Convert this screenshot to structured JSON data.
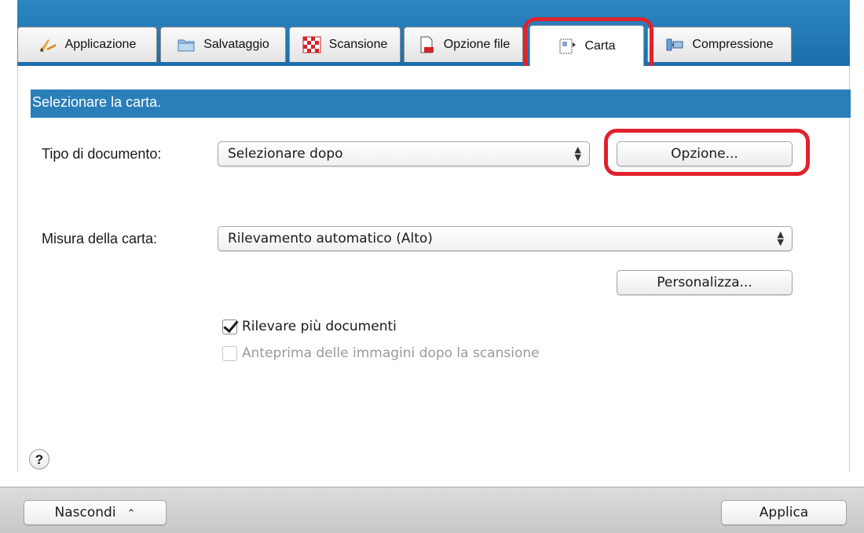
{
  "tabs": [
    {
      "label": "Applicazione",
      "icon": "pencil-icon"
    },
    {
      "label": "Salvataggio",
      "icon": "folder-icon"
    },
    {
      "label": "Scansione",
      "icon": "checker-icon"
    },
    {
      "label": "Opzione file",
      "icon": "file-icon"
    },
    {
      "label": "Carta",
      "icon": "paper-icon"
    },
    {
      "label": "Compressione",
      "icon": "compress-icon"
    }
  ],
  "section_title": "Selezionare la carta.",
  "document_type": {
    "label": "Tipo di documento:",
    "value": "Selezionare dopo",
    "option_button": "Opzione..."
  },
  "paper_size": {
    "label": "Misura della carta:",
    "value": "Rilevamento automatico (Alto)",
    "custom_button": "Personalizza..."
  },
  "checkboxes": {
    "multifeed": {
      "label": "Rilevare più documenti",
      "checked": true
    },
    "preview": {
      "label": "Anteprima delle immagini dopo la scansione",
      "checked": false,
      "enabled": false
    }
  },
  "help_label": "?",
  "bottom": {
    "hide_button": "Nascondi",
    "apply_button": "Applica"
  },
  "colors": {
    "accent_blue": "#2a7fb8",
    "highlight_red": "#e0222c"
  }
}
